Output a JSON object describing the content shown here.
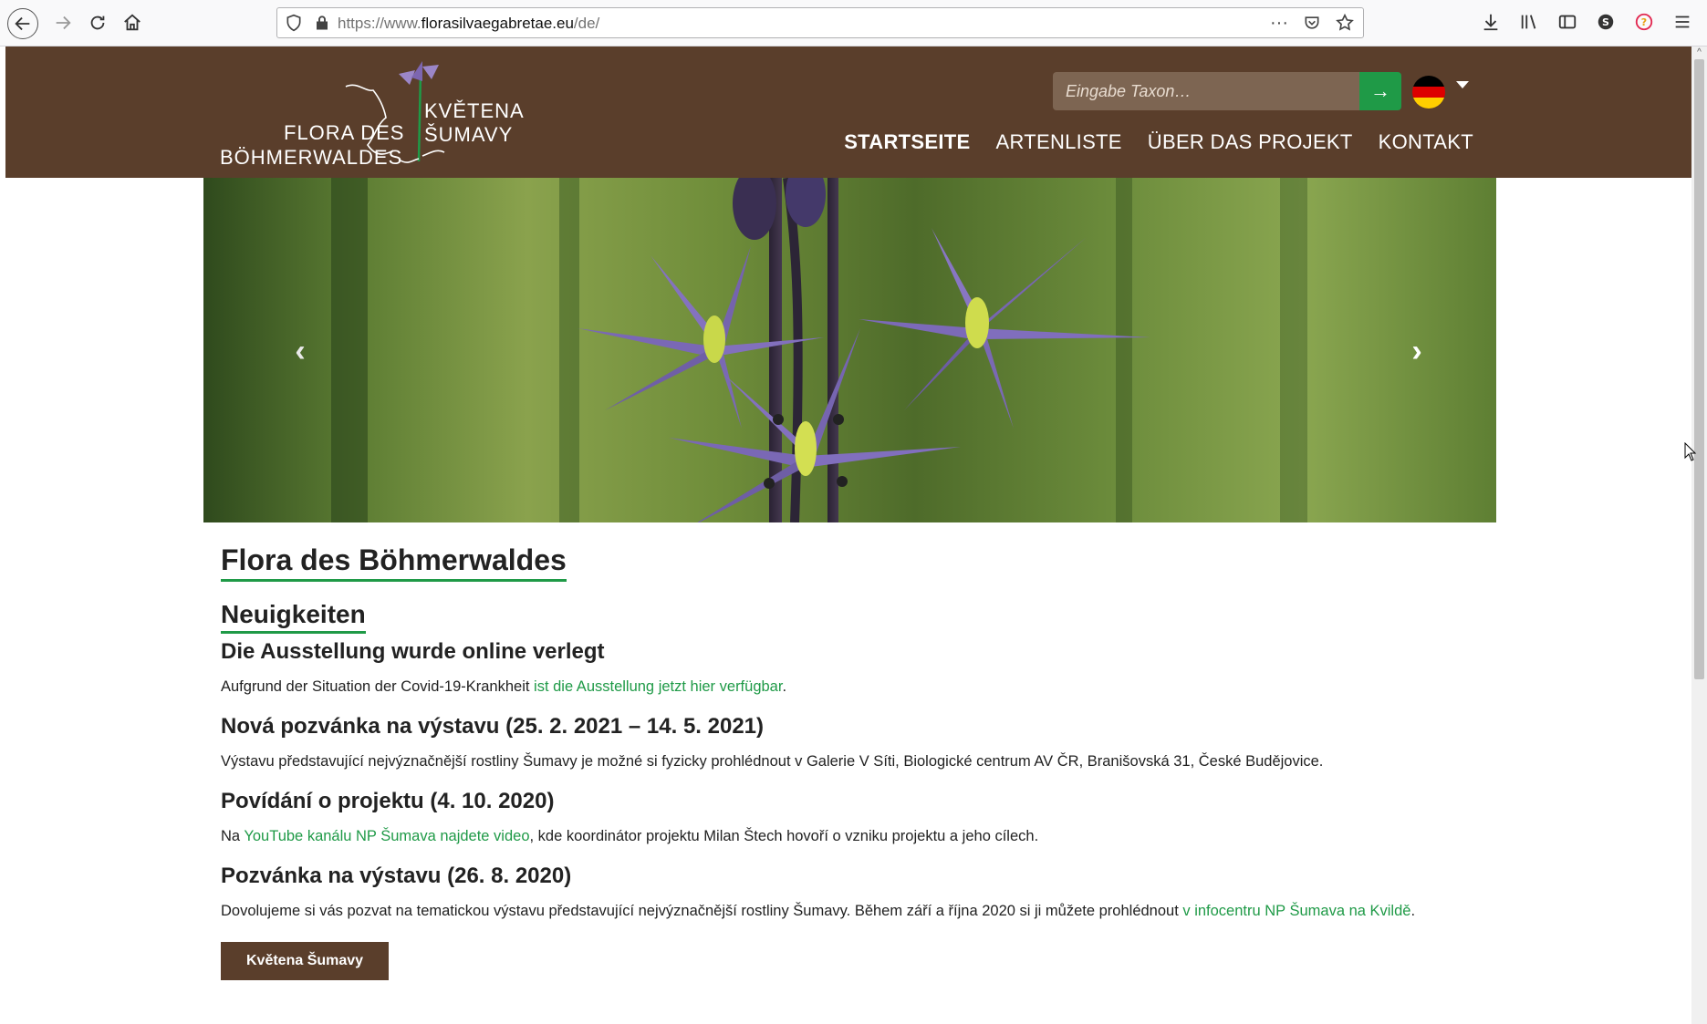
{
  "browser": {
    "url_prefix": "https://www.",
    "url_domain": "florasilvaegabretae.eu",
    "url_path": "/de/",
    "more_label": "···"
  },
  "header": {
    "logo": {
      "de_line1": "FLORA DES",
      "de_line2": "BÖHMERWALDES",
      "cz_line1": "KVĚTENA",
      "cz_line2": "ŠUMAVY"
    },
    "search": {
      "placeholder": "Eingabe Taxon…",
      "button_label": "→"
    },
    "nav": [
      {
        "label": "STARTSEITE",
        "active": true
      },
      {
        "label": "ARTENLISTE",
        "active": false
      },
      {
        "label": "ÜBER DAS PROJEKT",
        "active": false
      },
      {
        "label": "KONTAKT",
        "active": false
      }
    ]
  },
  "carousel": {
    "prev_label": "‹",
    "next_label": "›"
  },
  "content": {
    "title": "Flora des Böhmerwaldes",
    "news_heading": "Neuigkeiten",
    "news": [
      {
        "title": "Die Ausstellung wurde online verlegt",
        "text_before": "Aufgrund der Situation der Covid-19-Krankheit ",
        "link": "ist die Ausstellung jetzt hier verfügbar",
        "text_after": "."
      },
      {
        "title": "Nová pozvánka na výstavu (25. 2. 2021 – 14. 5. 2021)",
        "text_before": "Výstavu představující nejvýznačnější rostliny Šumavy je možné si fyzicky prohlédnout v Galerie V Síti, Biologické centrum AV ČR, Branišovská 31, České Budějovice.",
        "link": "",
        "text_after": ""
      },
      {
        "title": "Povídání o projektu (4. 10. 2020)",
        "text_before": "Na ",
        "link": "YouTube kanálu NP Šumava najdete video",
        "text_after": ", kde koordinátor projektu Milan Štech hovoří o vzniku projektu a jeho cílech."
      },
      {
        "title": "Pozvánka na výstavu (26. 8. 2020)",
        "text_before": "Dovolujeme si vás pozvat na tematickou výstavu představující nejvýznačnější rostliny Šumavy. Během září a října 2020 si ji můžete prohlédnout ",
        "link": "v infocentru NP Šumava na Kvildě",
        "text_after": "."
      }
    ],
    "button_label": "Květena Šumavy"
  },
  "colors": {
    "header_brown": "#5a3e2b",
    "accent_green": "#1f9a47"
  }
}
